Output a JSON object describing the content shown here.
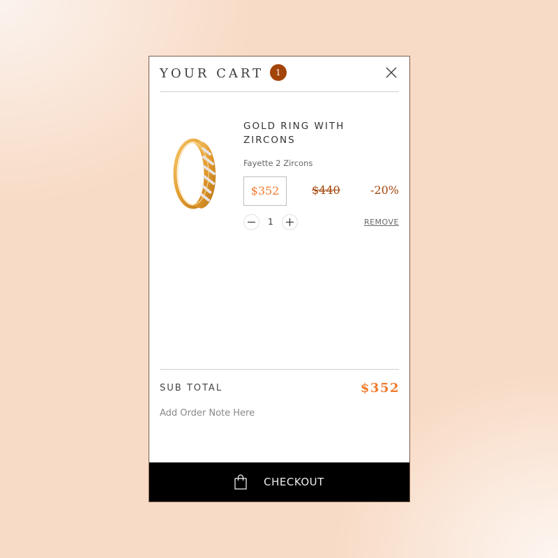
{
  "cart": {
    "title": "YOUR CART",
    "count": "1",
    "close_icon": "close-icon"
  },
  "item": {
    "name": "GOLD RING WITH ZIRCONS",
    "variant": "Fayette 2 Zircons",
    "price": "$352",
    "old_price": "$440",
    "discount": "-20%",
    "quantity": "1",
    "remove_label": "REMOVE",
    "image_icon": "gold-ring-image"
  },
  "summary": {
    "subtotal_label": "SUB TOTAL",
    "subtotal_value": "$352",
    "order_note": "Add Order Note Here"
  },
  "checkout": {
    "label": "CHECKOUT",
    "icon": "shopping-bag-icon"
  },
  "colors": {
    "accent": "#f07a2c",
    "badge": "#a34409",
    "discount": "#a34409",
    "checkout_bg": "#000000"
  }
}
